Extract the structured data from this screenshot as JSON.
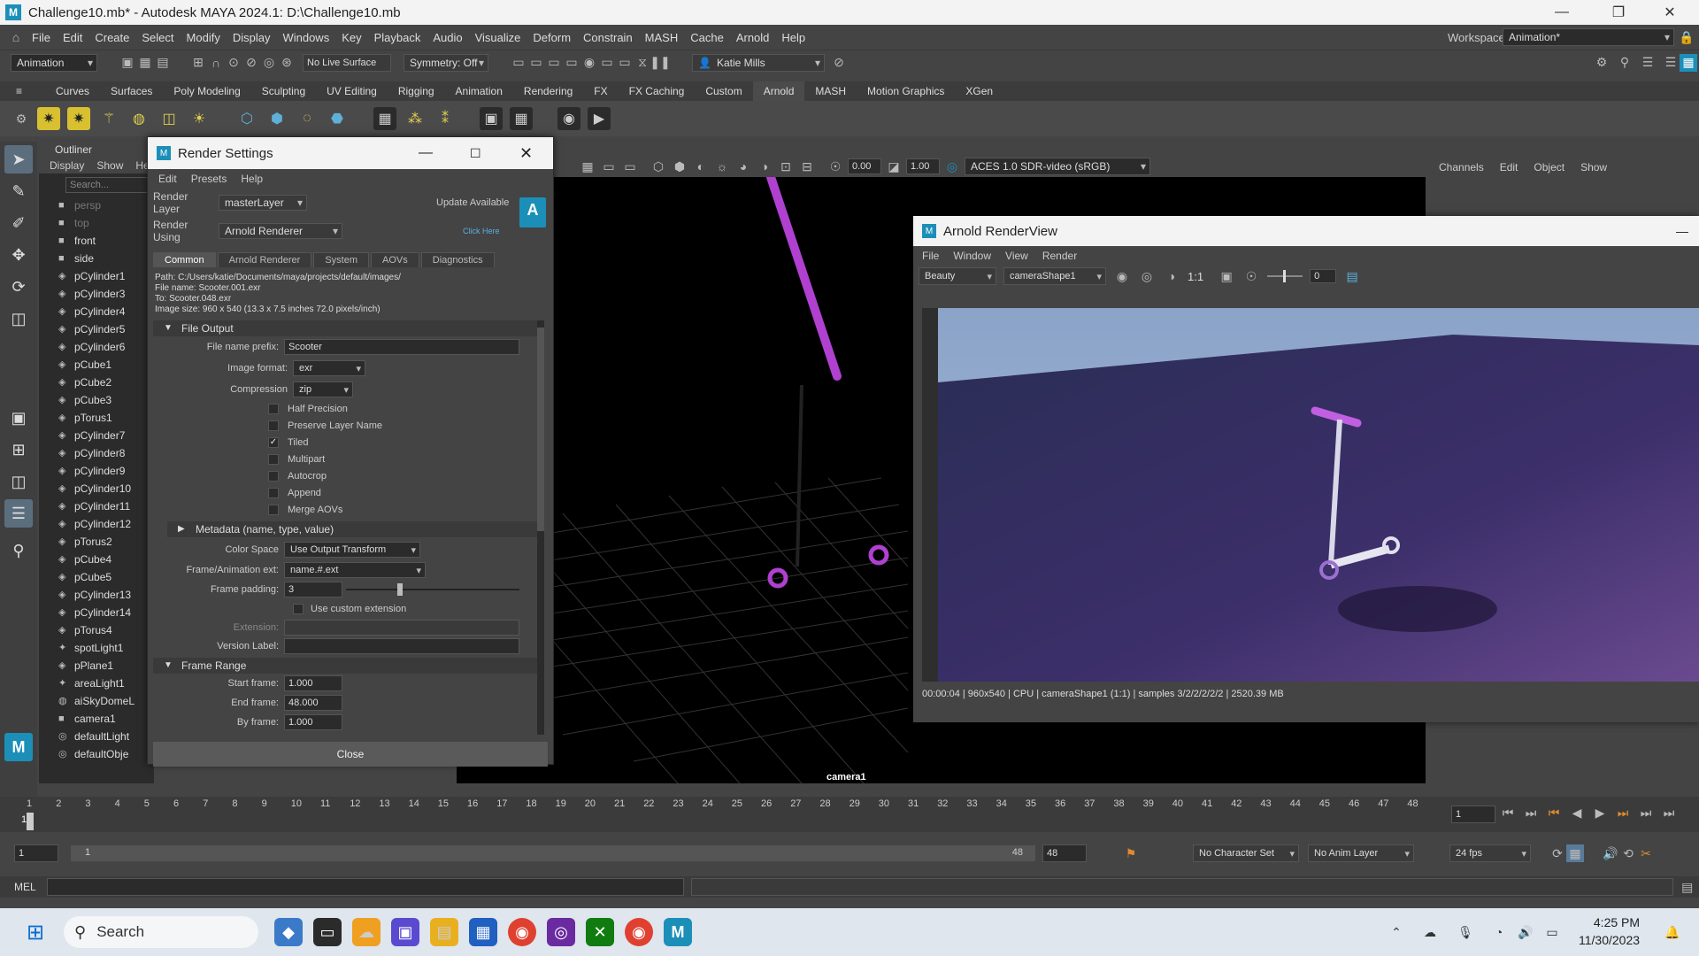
{
  "app": {
    "title": "Challenge10.mb* - Autodesk MAYA 2024.1: D:\\Challenge10.mb",
    "menus": [
      "File",
      "Edit",
      "Create",
      "Select",
      "Modify",
      "Display",
      "Windows",
      "Key",
      "Playback",
      "Audio",
      "Visualize",
      "Deform",
      "Constrain",
      "MASH",
      "Cache",
      "Arnold",
      "Help"
    ],
    "workspace_label": "Workspace:",
    "workspace_value": "Animation*"
  },
  "statusline": {
    "menuset": "Animation",
    "live_surface": "No Live Surface",
    "symmetry": "Symmetry: Off",
    "user": "Katie Mills"
  },
  "shelf_tabs": [
    "Curves",
    "Surfaces",
    "Poly Modeling",
    "Sculpting",
    "UV Editing",
    "Rigging",
    "Animation",
    "Rendering",
    "FX",
    "FX Caching",
    "Custom",
    "Arnold",
    "MASH",
    "Motion Graphics",
    "XGen"
  ],
  "shelf_active": "Arnold",
  "outliner": {
    "title": "Outliner",
    "menus": [
      "Display",
      "Show",
      "He"
    ],
    "search_placeholder": "Search...",
    "items": [
      {
        "label": "persp",
        "dim": true,
        "icon": "camera-icon"
      },
      {
        "label": "top",
        "dim": true,
        "icon": "camera-icon"
      },
      {
        "label": "front",
        "dim": false,
        "icon": "camera-icon"
      },
      {
        "label": "side",
        "dim": false,
        "icon": "camera-icon"
      },
      {
        "label": "pCylinder1",
        "icon": "mesh-icon"
      },
      {
        "label": "pCylinder3",
        "icon": "mesh-icon"
      },
      {
        "label": "pCylinder4",
        "icon": "mesh-icon"
      },
      {
        "label": "pCylinder5",
        "icon": "mesh-icon"
      },
      {
        "label": "pCylinder6",
        "icon": "mesh-icon"
      },
      {
        "label": "pCube1",
        "icon": "mesh-icon"
      },
      {
        "label": "pCube2",
        "icon": "mesh-icon"
      },
      {
        "label": "pCube3",
        "icon": "mesh-icon"
      },
      {
        "label": "pTorus1",
        "icon": "mesh-icon"
      },
      {
        "label": "pCylinder7",
        "icon": "mesh-icon"
      },
      {
        "label": "pCylinder8",
        "icon": "mesh-icon"
      },
      {
        "label": "pCylinder9",
        "icon": "mesh-icon"
      },
      {
        "label": "pCylinder10",
        "icon": "mesh-icon"
      },
      {
        "label": "pCylinder11",
        "icon": "mesh-icon"
      },
      {
        "label": "pCylinder12",
        "icon": "mesh-icon"
      },
      {
        "label": "pTorus2",
        "icon": "mesh-icon"
      },
      {
        "label": "pCube4",
        "icon": "mesh-icon"
      },
      {
        "label": "pCube5",
        "icon": "mesh-icon"
      },
      {
        "label": "pCylinder13",
        "icon": "mesh-icon"
      },
      {
        "label": "pCylinder14",
        "icon": "mesh-icon"
      },
      {
        "label": "pTorus4",
        "icon": "mesh-icon"
      },
      {
        "label": "spotLight1",
        "icon": "light-icon"
      },
      {
        "label": "pPlane1",
        "icon": "mesh-icon"
      },
      {
        "label": "areaLight1",
        "icon": "light-icon"
      },
      {
        "label": "aiSkyDomeL",
        "icon": "sky-icon"
      },
      {
        "label": "camera1",
        "icon": "camera-icon"
      },
      {
        "label": "defaultLight",
        "icon": "set-icon"
      },
      {
        "label": "defaultObje",
        "icon": "set-icon"
      }
    ]
  },
  "viewport": {
    "exposure": "0.00",
    "gamma": "1.00",
    "color_transform": "ACES 1.0 SDR-video (sRGB)",
    "camera_label": "camera1"
  },
  "channelbox": {
    "menus": [
      "Channels",
      "Edit",
      "Object",
      "Show"
    ]
  },
  "render_settings": {
    "title": "Render Settings",
    "menus": [
      "Edit",
      "Presets",
      "Help"
    ],
    "render_layer_label": "Render Layer",
    "render_layer": "masterLayer",
    "render_using_label": "Render Using",
    "render_using": "Arnold Renderer",
    "update_available": "Update Available",
    "click_here": "Click Here",
    "tabs": [
      "Common",
      "Arnold Renderer",
      "System",
      "AOVs",
      "Diagnostics"
    ],
    "path": "Path: C:/Users/katie/Documents/maya/projects/default/images/",
    "file_name": "File name:  Scooter.001.exr",
    "to": "To:             Scooter.048.exr",
    "image_size": "Image size: 960 x 540 (13.3 x 7.5 inches 72.0 pixels/inch)",
    "file_output": "File Output",
    "file_name_prefix_label": "File name prefix:",
    "file_name_prefix": "Scooter",
    "image_format_label": "Image format:",
    "image_format": "exr",
    "compression_label": "Compression",
    "compression": "zip",
    "checkboxes": [
      {
        "label": "Half Precision",
        "checked": false
      },
      {
        "label": "Preserve Layer Name",
        "checked": false
      },
      {
        "label": "Tiled",
        "checked": true
      },
      {
        "label": "Multipart",
        "checked": false
      },
      {
        "label": "Autocrop",
        "checked": false
      },
      {
        "label": "Append",
        "checked": false
      },
      {
        "label": "Merge AOVs",
        "checked": false
      }
    ],
    "metadata": "Metadata (name, type, value)",
    "color_space_label": "Color Space",
    "color_space": "Use Output Transform",
    "frame_ext_label": "Frame/Animation ext:",
    "frame_ext": "name.#.ext",
    "frame_padding_label": "Frame padding:",
    "frame_padding": "3",
    "use_custom_ext": "Use custom extension",
    "extension_label": "Extension:",
    "version_label": "Version Label:",
    "frame_range": "Frame Range",
    "start_frame_label": "Start frame:",
    "start_frame": "1.000",
    "end_frame_label": "End frame:",
    "end_frame": "48.000",
    "by_frame_label": "By frame:",
    "by_frame": "1.000",
    "close": "Close"
  },
  "render_view": {
    "title": "Arnold RenderView",
    "menus": [
      "File",
      "Window",
      "View",
      "Render"
    ],
    "aov": "Beauty",
    "camera": "cameraShape1",
    "ratio": "1:1",
    "exposure": "0",
    "status": "00:00:04 | 960x540 | CPU | cameraShape1 (1:1) | samples 3/2/2/2/2/2 | 2520.39 MB"
  },
  "timeline": {
    "ticks": [
      "1",
      "2",
      "3",
      "4",
      "5",
      "6",
      "7",
      "8",
      "9",
      "10",
      "11",
      "12",
      "13",
      "14",
      "15",
      "16",
      "17",
      "18",
      "19",
      "20",
      "21",
      "22",
      "23",
      "24",
      "25",
      "26",
      "27",
      "28",
      "29",
      "30",
      "31",
      "32",
      "33",
      "34",
      "35",
      "36",
      "37",
      "38",
      "39",
      "40",
      "41",
      "42",
      "43",
      "44",
      "45",
      "46",
      "47",
      "48"
    ],
    "current_frame": "1"
  },
  "range": {
    "start": "1",
    "inner_start": "1",
    "inner_end": "48",
    "end": "48",
    "character_set": "No Character Set",
    "anim_layer": "No Anim Layer",
    "fps": "24 fps"
  },
  "cmdline": {
    "label": "MEL"
  },
  "taskbar": {
    "search": "Search",
    "time": "4:25 PM",
    "date": "11/30/2023"
  }
}
